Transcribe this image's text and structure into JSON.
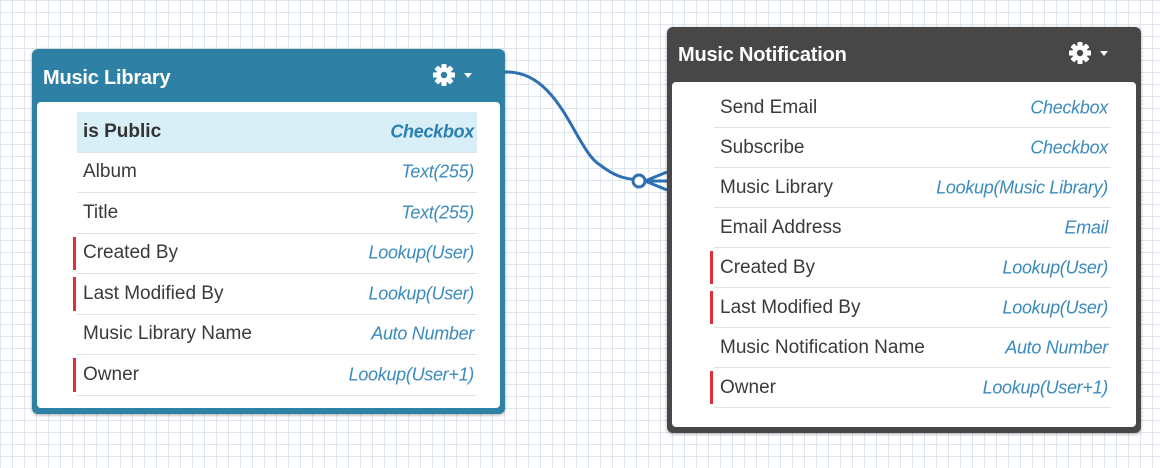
{
  "colors": {
    "library_header": "#2f80a5",
    "notification_header": "#474747",
    "relationship_line": "#2f6fb3",
    "required_marker": "#e0313a",
    "type_text": "#3b8abd",
    "highlight_row": "#d8eff8"
  },
  "objects": [
    {
      "title": "Music Library",
      "fields": [
        {
          "name": "is Public",
          "type": "Checkbox",
          "required": false,
          "highlighted": true
        },
        {
          "name": "Album",
          "type": "Text(255)",
          "required": false,
          "highlighted": false
        },
        {
          "name": "Title",
          "type": "Text(255)",
          "required": false,
          "highlighted": false
        },
        {
          "name": "Created By",
          "type": "Lookup(User)",
          "required": true,
          "highlighted": false
        },
        {
          "name": "Last Modified By",
          "type": "Lookup(User)",
          "required": true,
          "highlighted": false
        },
        {
          "name": "Music Library Name",
          "type": "Auto Number",
          "required": false,
          "highlighted": false
        },
        {
          "name": "Owner",
          "type": "Lookup(User+1)",
          "required": true,
          "highlighted": false
        }
      ]
    },
    {
      "title": "Music Notification",
      "fields": [
        {
          "name": "Send Email",
          "type": "Checkbox",
          "required": false,
          "highlighted": false
        },
        {
          "name": "Subscribe",
          "type": "Checkbox",
          "required": false,
          "highlighted": false
        },
        {
          "name": "Music Library",
          "type": "Lookup(Music Library)",
          "required": false,
          "highlighted": false
        },
        {
          "name": "Email Address",
          "type": "Email",
          "required": false,
          "highlighted": false
        },
        {
          "name": "Created By",
          "type": "Lookup(User)",
          "required": true,
          "highlighted": false
        },
        {
          "name": "Last Modified By",
          "type": "Lookup(User)",
          "required": true,
          "highlighted": false
        },
        {
          "name": "Music Notification Name",
          "type": "Auto Number",
          "required": false,
          "highlighted": false
        },
        {
          "name": "Owner",
          "type": "Lookup(User+1)",
          "required": true,
          "highlighted": false
        }
      ]
    }
  ],
  "icons": {
    "header_menu": "gear-icon",
    "menu_caret": "caret-down-icon",
    "relationship_end": "crow-foot-icon"
  }
}
